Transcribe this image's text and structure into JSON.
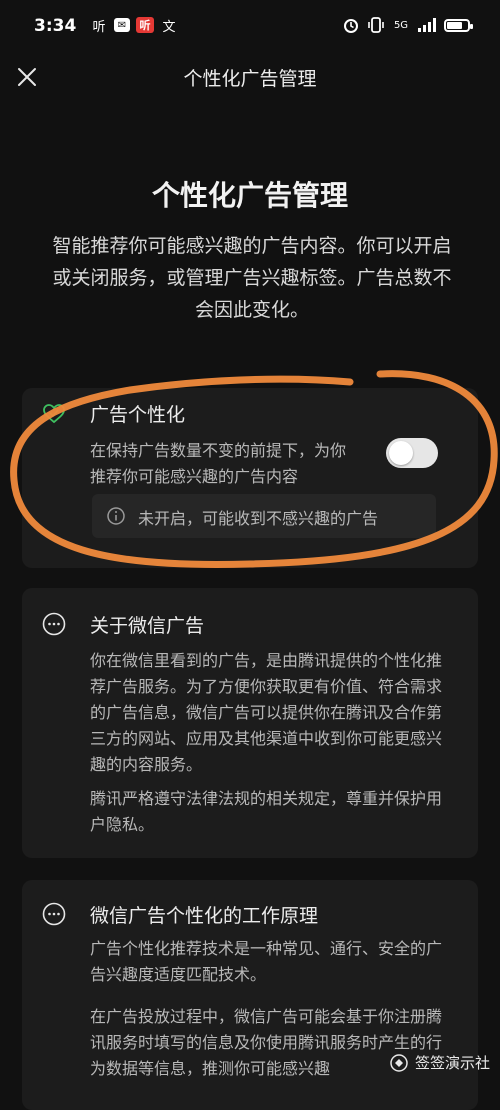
{
  "status_bar": {
    "time": "3:34",
    "left_icons": [
      "听",
      "mail-icon",
      "听",
      "文"
    ],
    "network": "5G"
  },
  "header": {
    "title": "个性化广告管理"
  },
  "intro": {
    "heading": "个性化广告管理",
    "description": "智能推荐你可能感兴趣的广告内容。你可以开启或关闭服务，或管理广告兴趣标签。广告总数不会因此变化。"
  },
  "ad_personalization": {
    "title": "广告个性化",
    "desc_line1": "在保持广告数量不变的前提下，为你",
    "desc_line2": "推荐你可能感兴趣的广告内容",
    "toggle_on": false,
    "notice": "未开启，可能收到不感兴趣的广告"
  },
  "about": {
    "title": "关于微信广告",
    "paragraph1": "你在微信里看到的广告，是由腾讯提供的个性化推荐广告服务。为了方便你获取更有价值、符合需求的广告信息，微信广告可以提供你在腾讯及合作第三方的网站、应用及其他渠道中收到你可能更感兴趣的内容服务。",
    "paragraph2": "腾讯严格遵守法律法规的相关规定，尊重并保护用户隐私。"
  },
  "principle": {
    "title": "微信广告个性化的工作原理",
    "paragraph1": "广告个性化推荐技术是一种常见、通行、安全的广告兴趣度适度匹配技术。",
    "paragraph2": "在广告投放过程中，微信广告可能会基于你注册腾讯服务时填写的信息及你使用腾讯服务时产生的行为数据等信息，推测你可能感兴趣"
  },
  "watermark": {
    "text": "签签演示社"
  },
  "colors": {
    "background": "#111111",
    "card": "#1c1c1c",
    "annotation": "#f08a3c",
    "heart_icon": "#3fbf60"
  }
}
